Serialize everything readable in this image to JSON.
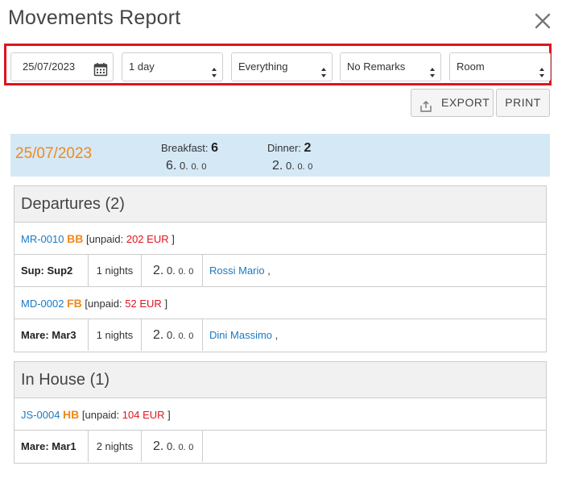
{
  "title": "Movements Report",
  "filters": {
    "date": "25/07/2023",
    "duration": "1 day",
    "scope": "Everything",
    "remarks": "No Remarks",
    "sort": "Room"
  },
  "actions": {
    "export_label": "EXPORT",
    "print_label": "PRINT"
  },
  "day": {
    "date": "25/07/2023",
    "breakfast_label": "Breakfast:",
    "breakfast_total": "6",
    "breakfast_breakdown": [
      "6.",
      "0.",
      "0.",
      "0"
    ],
    "dinner_label": "Dinner:",
    "dinner_total": "2",
    "dinner_breakdown": [
      "2.",
      "0.",
      "0.",
      "0"
    ]
  },
  "departures": {
    "heading": "Departures (2)",
    "bookings": [
      {
        "code": "MR-0010",
        "plan": "BB",
        "unpaid_prefix": "[unpaid:",
        "unpaid_amount": "202 EUR",
        "unpaid_suffix": "]",
        "room": "Sup: Sup2",
        "nights": "1 nights",
        "meals": [
          "2.",
          "0.",
          "0.",
          "0"
        ],
        "guest": "Rossi Mario",
        "guest_suffix": ","
      },
      {
        "code": "MD-0002",
        "plan": "FB",
        "unpaid_prefix": "[unpaid:",
        "unpaid_amount": "52 EUR",
        "unpaid_suffix": "]",
        "room": "Mare: Mar3",
        "nights": "1 nights",
        "meals": [
          "2.",
          "0.",
          "0.",
          "0"
        ],
        "guest": "Dini Massimo",
        "guest_suffix": ","
      }
    ]
  },
  "inhouse": {
    "heading": "In House (1)",
    "bookings": [
      {
        "code": "JS-0004",
        "plan": "HB",
        "unpaid_prefix": "[unpaid:",
        "unpaid_amount": "104 EUR",
        "unpaid_suffix": "]",
        "room": "Mare: Mar1",
        "nights": "2 nights",
        "meals": [
          "2.",
          "0.",
          "0.",
          "0"
        ]
      }
    ]
  },
  "colors": {
    "accent_orange": "#f0891a",
    "link_blue": "#1a7ac4",
    "alert_red": "#e0141e",
    "day_bar": "#d5e8f6"
  },
  "icons": [
    "close-icon",
    "calendar-icon",
    "select-arrows-icon",
    "export-icon"
  ]
}
